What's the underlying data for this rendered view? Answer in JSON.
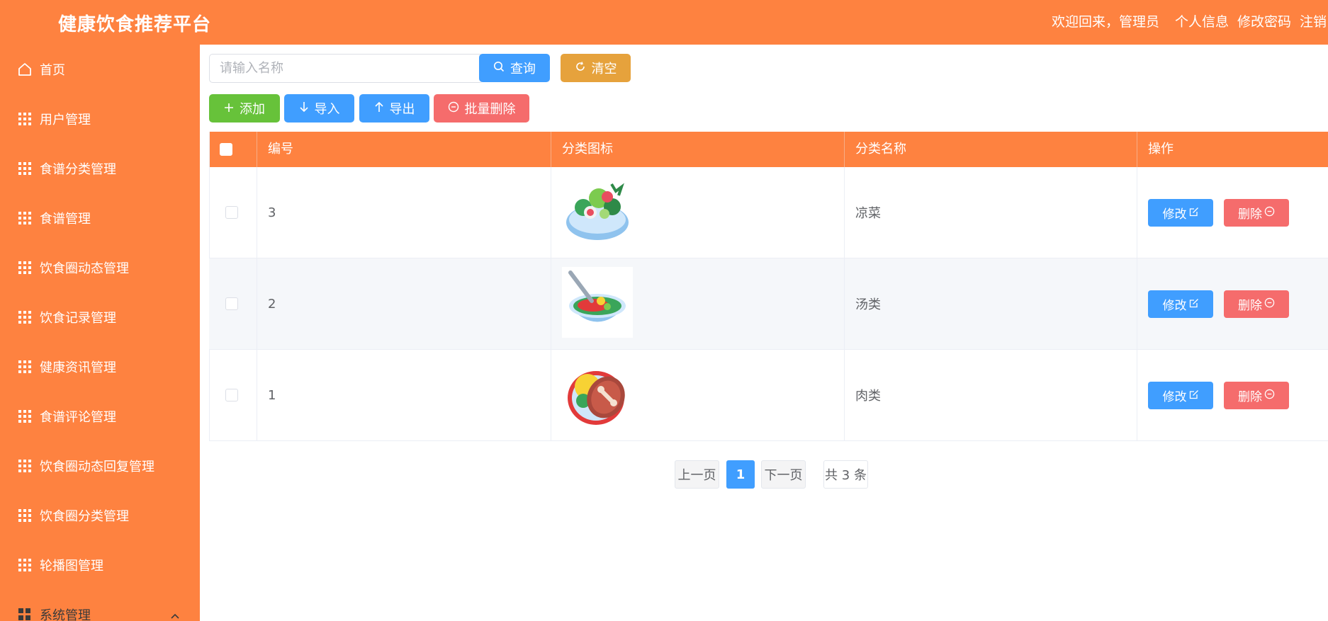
{
  "header": {
    "title": "健康饮食推荐平台",
    "welcome": "欢迎回来，管理员",
    "links": [
      "个人信息",
      "修改密码",
      "注销"
    ]
  },
  "sidebar": {
    "items": [
      {
        "label": "首页",
        "icon": "home-icon"
      },
      {
        "label": "用户管理",
        "icon": "grid-icon"
      },
      {
        "label": "食谱分类管理",
        "icon": "grid-icon"
      },
      {
        "label": "食谱管理",
        "icon": "grid-icon"
      },
      {
        "label": "饮食圈动态管理",
        "icon": "grid-icon"
      },
      {
        "label": "饮食记录管理",
        "icon": "grid-icon"
      },
      {
        "label": "健康资讯管理",
        "icon": "grid-icon"
      },
      {
        "label": "食谱评论管理",
        "icon": "grid-icon"
      },
      {
        "label": "饮食圈动态回复管理",
        "icon": "grid-icon"
      },
      {
        "label": "饮食圈分类管理",
        "icon": "grid-icon"
      },
      {
        "label": "轮播图管理",
        "icon": "grid-icon"
      },
      {
        "label": "系统管理",
        "icon": "menu-icon"
      }
    ]
  },
  "search": {
    "placeholder": "请输入名称",
    "query_label": "查询",
    "clear_label": "清空"
  },
  "toolbar": {
    "add_label": "添加",
    "import_label": "导入",
    "export_label": "导出",
    "batch_delete_label": "批量删除"
  },
  "table": {
    "columns": [
      "编号",
      "分类图标",
      "分类名称",
      "操作"
    ],
    "rows": [
      {
        "id": "3",
        "icon": "salad-bowl",
        "name": "凉菜"
      },
      {
        "id": "2",
        "icon": "soup-bowl",
        "name": "汤类"
      },
      {
        "id": "1",
        "icon": "meat-plate",
        "name": "肉类"
      }
    ],
    "edit_label": "修改",
    "delete_label": "删除"
  },
  "pagination": {
    "prev_label": "上一页",
    "current_page": "1",
    "next_label": "下一页",
    "total_label": "共 3 条"
  },
  "colors": {
    "primary": "#FE8240",
    "blue": "#409EFF",
    "gold": "#E6A23C",
    "green": "#67C23A",
    "red": "#F56C6C"
  }
}
